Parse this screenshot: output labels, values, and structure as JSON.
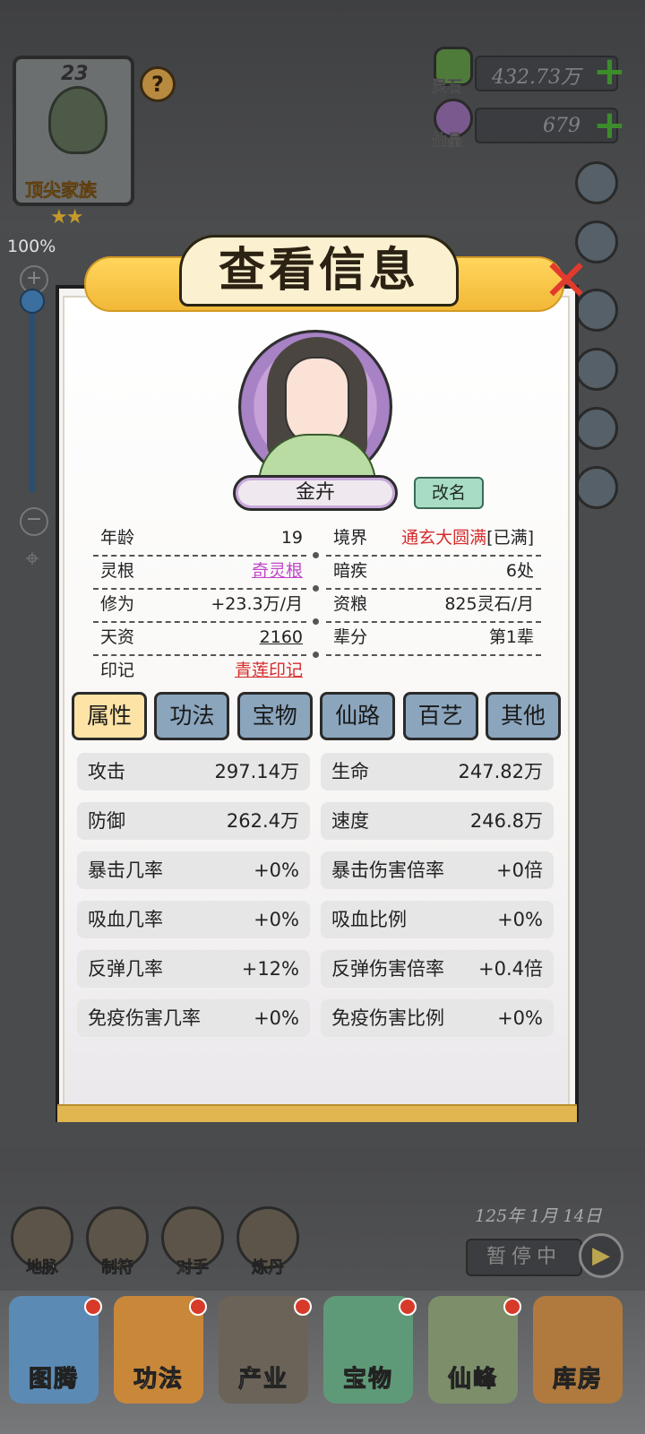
{
  "family": {
    "level": "23",
    "rank": "顶尖家族",
    "stars": "★★"
  },
  "zoom": {
    "percent": "100%",
    "value": 1.0
  },
  "currency": {
    "lingshi": {
      "label": "灵石",
      "value": "432.73万"
    },
    "xianjing": {
      "label": "仙晶",
      "value": "679"
    }
  },
  "dialog": {
    "title": "查看信息",
    "name": "金卉",
    "rename_label": "改名",
    "info_left": [
      {
        "k": "年龄",
        "v": "19"
      },
      {
        "k": "灵根",
        "v": "奇灵根"
      },
      {
        "k": "修为",
        "v": "+23.3万/月"
      },
      {
        "k": "天资",
        "v": "2160"
      },
      {
        "k": "印记",
        "v": "青莲印记"
      }
    ],
    "info_right": [
      {
        "k": "境界",
        "v": "通玄大圆满",
        "v2": "[已满]"
      },
      {
        "k": "暗疾",
        "v": "6处"
      },
      {
        "k": "资粮",
        "v": "825灵石/月"
      },
      {
        "k": "辈分",
        "v": "第1辈"
      }
    ],
    "tabs": [
      "属性",
      "功法",
      "宝物",
      "仙路",
      "百艺",
      "其他"
    ],
    "stats_left": [
      {
        "k": "攻击",
        "v": "297.14万"
      },
      {
        "k": "防御",
        "v": "262.4万"
      },
      {
        "k": "暴击几率",
        "v": "+0%"
      },
      {
        "k": "吸血几率",
        "v": "+0%"
      },
      {
        "k": "反弹几率",
        "v": "+12%"
      },
      {
        "k": "免疫伤害几率",
        "v": "+0%"
      }
    ],
    "stats_right": [
      {
        "k": "生命",
        "v": "247.82万"
      },
      {
        "k": "速度",
        "v": "246.8万"
      },
      {
        "k": "暴击伤害倍率",
        "v": "+0倍"
      },
      {
        "k": "吸血比例",
        "v": "+0%"
      },
      {
        "k": "反弹伤害倍率",
        "v": "+0.4倍"
      },
      {
        "k": "免疫伤害比例",
        "v": "+0%"
      }
    ]
  },
  "hud": {
    "date": "125年 1月 14日",
    "pause_label": "暂停中",
    "quick": [
      "地脉",
      "制符",
      "对手",
      "炼丹"
    ],
    "nav": [
      "图腾",
      "功法",
      "产业",
      "宝物",
      "仙峰",
      "库房"
    ]
  },
  "colors": {
    "accent_red": "#d72c2c",
    "purple": "#c246c9",
    "tab_active": "#fde3a6",
    "tab": "#8ba5bd",
    "ribbon": "#f2b838"
  }
}
